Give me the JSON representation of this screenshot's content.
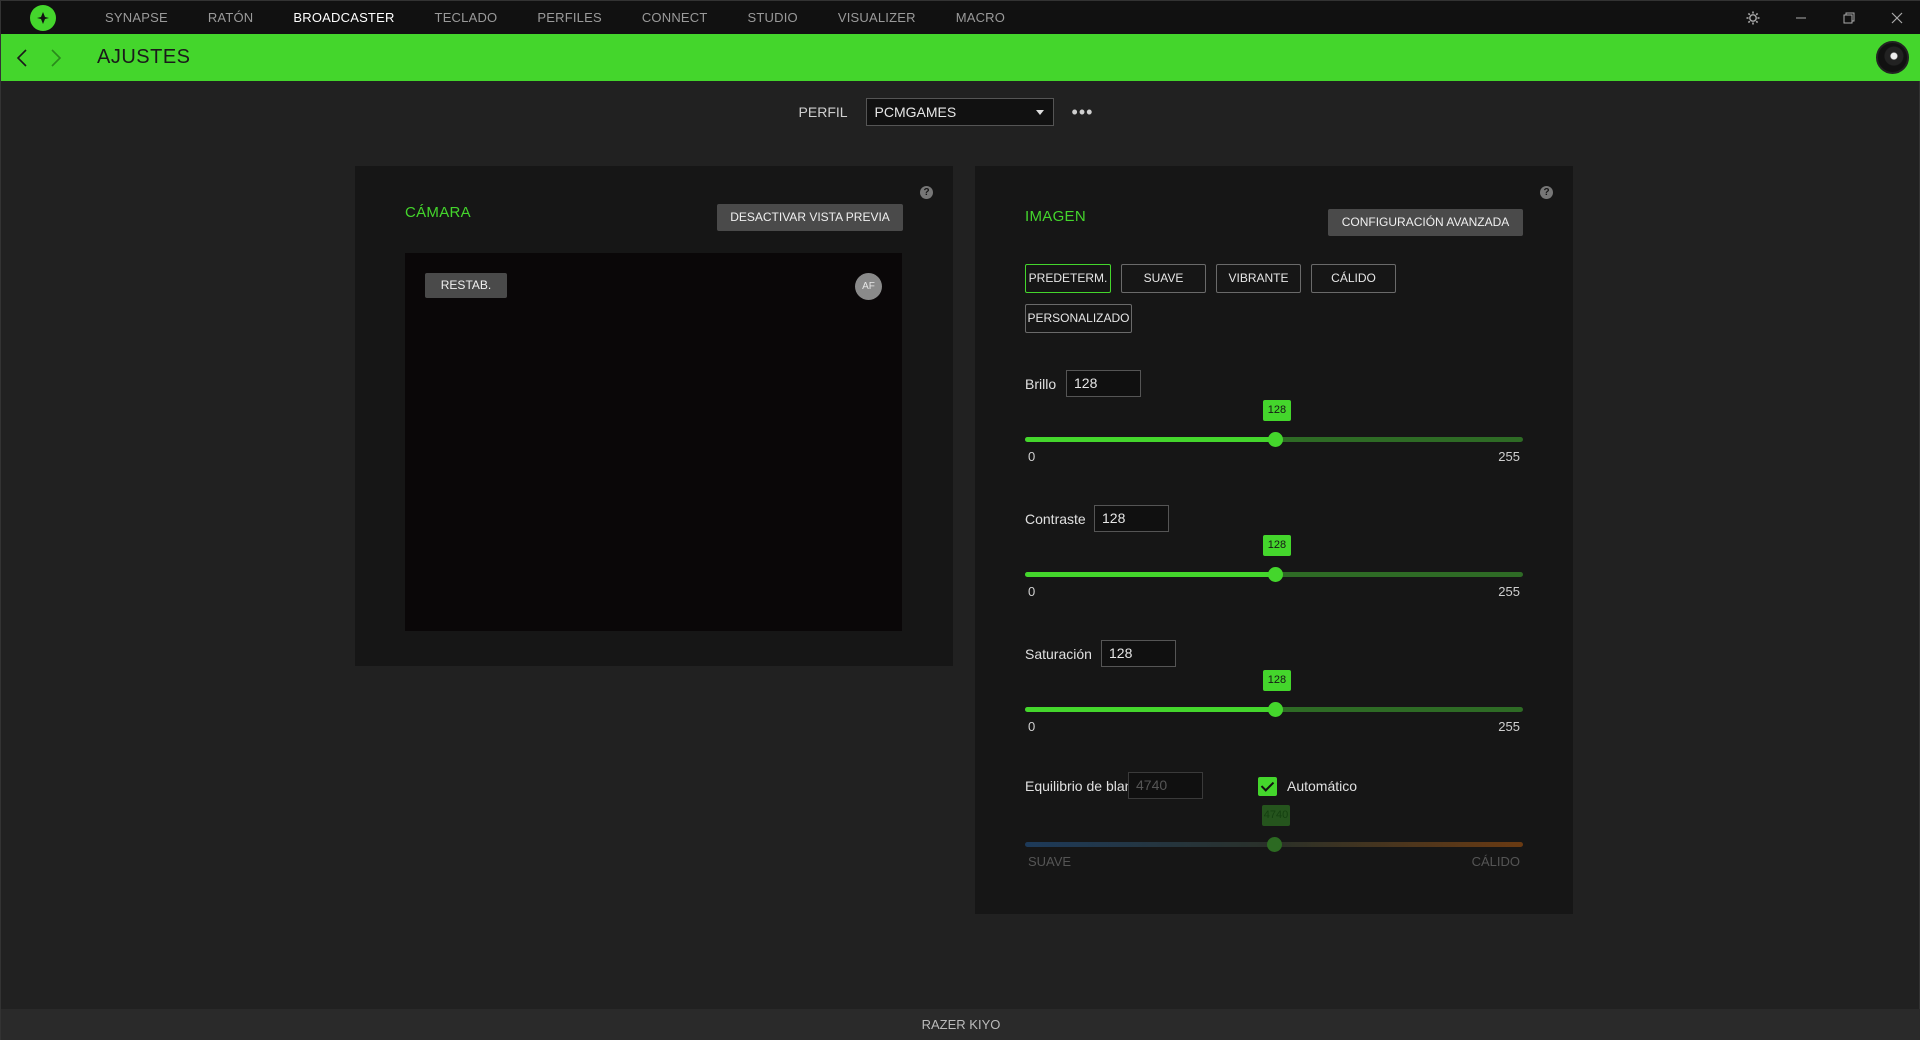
{
  "nav": {
    "items": [
      "SYNAPSE",
      "RATÓN",
      "BROADCASTER",
      "TECLADO",
      "PERFILES",
      "CONNECT",
      "STUDIO",
      "VISUALIZER",
      "MACRO"
    ],
    "active": "BROADCASTER"
  },
  "header": {
    "title": "AJUSTES"
  },
  "profile": {
    "label": "PERFIL",
    "selected": "PCMGAMES",
    "more": "•••"
  },
  "camera": {
    "title": "CÁMARA",
    "toggle_preview_label": "DESACTIVAR VISTA PREVIA",
    "reset_label": "RESTAB.",
    "af_label": "AF"
  },
  "image": {
    "title": "IMAGEN",
    "advanced_label": "CONFIGURACIÓN AVANZADA",
    "presets": [
      "PREDETERM.",
      "SUAVE",
      "VIBRANTE",
      "CÁLIDO",
      "PERSONALIZADO"
    ],
    "active_preset": "PREDETERM.",
    "brightness": {
      "label": "Brillo",
      "value": "128",
      "min": "0",
      "max": "255",
      "fraction": 0.502
    },
    "contrast": {
      "label": "Contraste",
      "value": "128",
      "min": "0",
      "max": "255",
      "fraction": 0.502
    },
    "saturation": {
      "label": "Saturación",
      "value": "128",
      "min": "0",
      "max": "255",
      "fraction": 0.502
    },
    "white_balance": {
      "label": "Equilibrio de blancos",
      "value": "4740",
      "auto_label": "Automático",
      "auto": true,
      "min_label": "SUAVE",
      "max_label": "CÁLIDO",
      "fraction": 0.5
    }
  },
  "help_icon": "?",
  "device": {
    "name": "RAZER KIYO"
  },
  "colors": {
    "accent": "#44d62c",
    "panel": "#161616",
    "background": "#212121"
  }
}
